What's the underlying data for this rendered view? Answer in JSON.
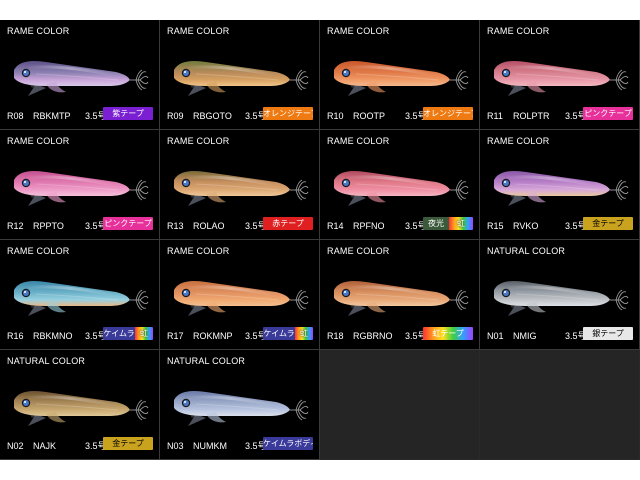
{
  "cells": [
    {
      "series": "RAME COLOR",
      "code": "R08",
      "name": "RBKMTP",
      "size": "3.5号",
      "tag": "紫テープ",
      "tag_bg": "#7a1fd2",
      "tag_fg": "#ffffff",
      "body": "#8a7fb0",
      "back": "#5d5086",
      "belly": "#d8c8e8",
      "shine": "#c9a4d9"
    },
    {
      "series": "RAME COLOR",
      "code": "R09",
      "name": "RBGOTO",
      "size": "3.5号",
      "tag": "オレンジテープ",
      "tag_bg": "#ef7a12",
      "tag_fg": "#ffffff",
      "body": "#b88a5a",
      "back": "#6f7a3d",
      "belly": "#f0c48a",
      "shine": "#d6a060"
    },
    {
      "series": "RAME COLOR",
      "code": "R10",
      "name": "ROOTP",
      "size": "3.5号",
      "tag": "オレンジテープ",
      "tag_bg": "#ef7a12",
      "tag_fg": "#ffffff",
      "body": "#e07a48",
      "back": "#c9582c",
      "belly": "#f4b78d",
      "shine": "#f09a66"
    },
    {
      "series": "RAME COLOR",
      "code": "R11",
      "name": "ROLPTR",
      "size": "3.5号",
      "tag": "ピンクテープ",
      "tag_bg": "#e8309a",
      "tag_fg": "#ffffff",
      "body": "#d67e8c",
      "back": "#b55068",
      "belly": "#f2b8c0",
      "shine": "#e898a8"
    },
    {
      "series": "RAME COLOR",
      "code": "R12",
      "name": "RPPTO",
      "size": "3.5号",
      "tag": "ピンクテープ",
      "tag_bg": "#e8309a",
      "tag_fg": "#ffffff",
      "body": "#e07ab0",
      "back": "#c45090",
      "belly": "#f4c0da",
      "shine": "#ee9cc8"
    },
    {
      "series": "RAME COLOR",
      "code": "R13",
      "name": "ROLAO",
      "size": "3.5号",
      "tag": "赤テープ",
      "tag_bg": "#e02020",
      "tag_fg": "#ffffff",
      "body": "#c89060",
      "back": "#7a6a3a",
      "belly": "#f0c898",
      "shine": "#dca874"
    },
    {
      "series": "RAME COLOR",
      "code": "R14",
      "name": "RPFNO",
      "size": "3.5号",
      "tag": "夜光",
      "tag2": "虹",
      "tag_bg": "#3b5a3b",
      "tag_fg": "#ffffff",
      "body": "#e07a88",
      "back": "#b04a60",
      "belly": "#f4b4c0",
      "shine": "#f090a4"
    },
    {
      "series": "RAME COLOR",
      "code": "R15",
      "name": "RVKO",
      "size": "3.5号",
      "tag": "金テープ",
      "tag_bg": "#c9a21e",
      "tag_fg": "#000000",
      "body": "#b880c8",
      "back": "#8a58a8",
      "belly": "#e8c8a0",
      "shine": "#d8a8d8"
    },
    {
      "series": "RAME COLOR",
      "code": "R16",
      "name": "RBKMNO",
      "size": "3.5号",
      "tag": "ケイムラ",
      "tag2": "虹",
      "tag_bg": "#3a3a9a",
      "tag_fg": "#ffffff",
      "body": "#6ab0c8",
      "back": "#3a86a8",
      "belly": "#e8b888",
      "shine": "#98d0e0"
    },
    {
      "series": "RAME COLOR",
      "code": "R17",
      "name": "ROKMNP",
      "size": "3.5号",
      "tag": "ケイムラ",
      "tag2": "虹",
      "tag_bg": "#3a3a9a",
      "tag_fg": "#ffffff",
      "body": "#e09060",
      "back": "#c87040",
      "belly": "#f4c090",
      "shine": "#f0a870"
    },
    {
      "series": "RAME COLOR",
      "code": "R18",
      "name": "RGBRNO",
      "size": "3.5号",
      "tag": "虹テープ",
      "tag_bg": "#ff5050",
      "tag_fg": "#ffffff",
      "body": "#d89060",
      "back": "#b06038",
      "belly": "#f4c8a0",
      "shine": "#e8a878"
    },
    {
      "series": "NATURAL COLOR",
      "code": "N01",
      "name": "NMIG",
      "size": "3.5号",
      "tag": "銀テープ",
      "tag_bg": "#e8e8e8",
      "tag_fg": "#000000",
      "body": "#9aa0a8",
      "back": "#5a6068",
      "belly": "#dde0e4",
      "shine": "#c0c4c8"
    },
    {
      "series": "NATURAL COLOR",
      "code": "N02",
      "name": "NAJK",
      "size": "3.5号",
      "tag": "金テープ",
      "tag_bg": "#c9a21e",
      "tag_fg": "#000000",
      "body": "#a88858",
      "back": "#6a5030",
      "belly": "#e0c898",
      "shine": "#c8a870"
    },
    {
      "series": "NATURAL COLOR",
      "code": "N03",
      "name": "NUMKM",
      "size": "3.5号",
      "tag": "ケイムラボディ",
      "tag_bg": "#3a3a9a",
      "tag_fg": "#ffffff",
      "body": "#9aa8c8",
      "back": "#6a7aa8",
      "belly": "#dce0ec",
      "shine": "#b8c4e0"
    }
  ],
  "rainbow": [
    "#ff3030",
    "#ff9a20",
    "#ffe020",
    "#40d040",
    "#30a0ff",
    "#a040ff"
  ]
}
